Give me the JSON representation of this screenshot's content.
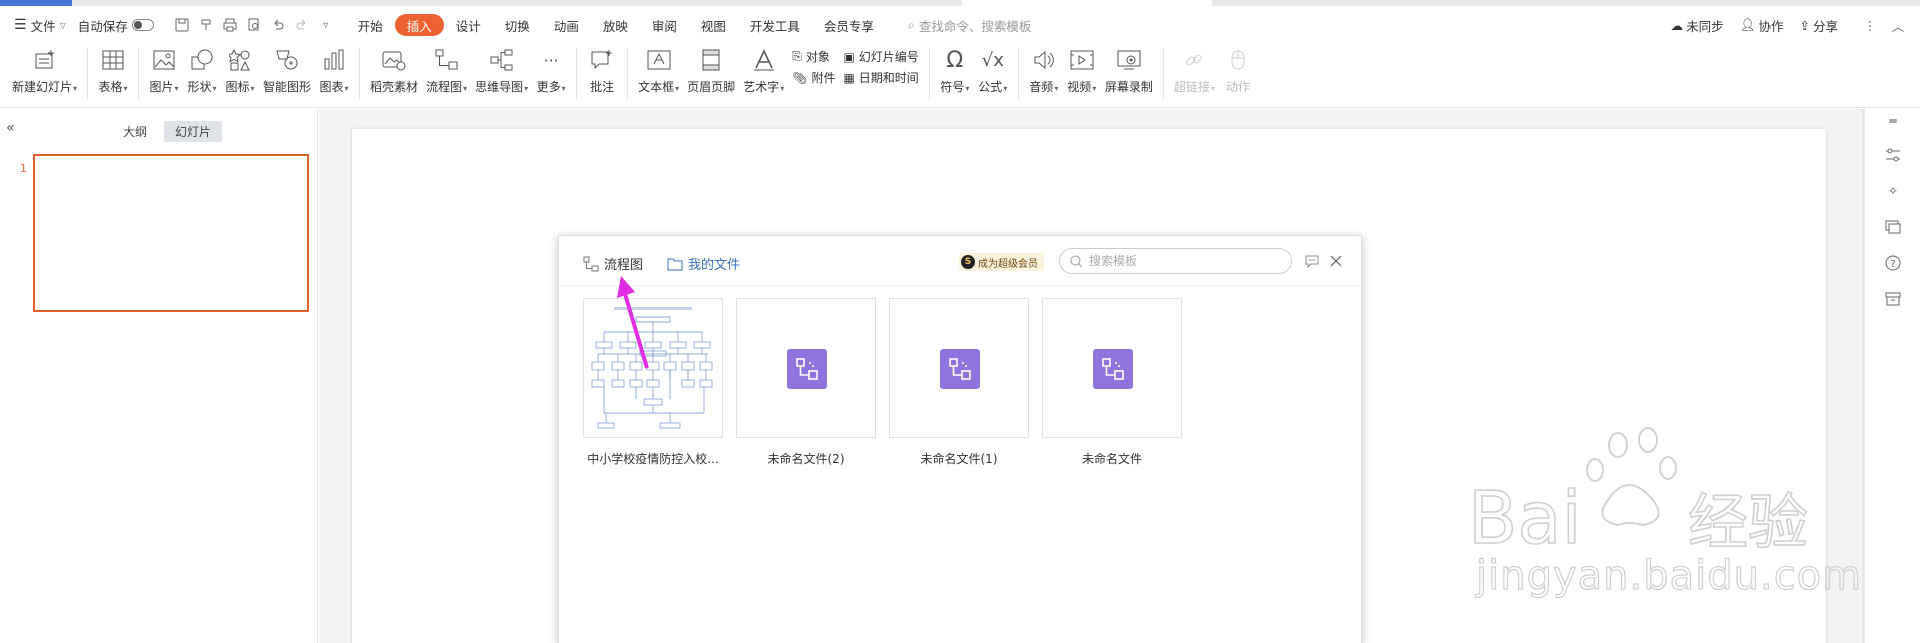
{
  "colors": {
    "accent": "#ec6231",
    "flow_icon": "#8f74de",
    "arrow": "#e02ee0"
  },
  "menubar": {
    "file_label": "文件",
    "autosave_label": "自动保存",
    "tabs": [
      "开始",
      "插入",
      "设计",
      "切换",
      "动画",
      "放映",
      "审阅",
      "视图",
      "开发工具",
      "会员专享"
    ],
    "active_tab": "插入",
    "search_cmd": "查找命令、搜索模板",
    "sync_label": "未同步",
    "collab_label": "协作",
    "share_label": "分享"
  },
  "ribbon": {
    "new_slide": "新建幻灯片",
    "table": "表格",
    "picture": "图片",
    "shape": "形状",
    "icon": "图标",
    "smart_graphic": "智能图形",
    "chart": "图表",
    "daoke": "稻壳素材",
    "flowchart": "流程图",
    "mindmap": "思维导图",
    "more": "更多",
    "comment": "批注",
    "textbox": "文本框",
    "header_footer": "页眉页脚",
    "wordart": "艺术字",
    "object": "对象",
    "attachment": "附件",
    "slide_number": "幻灯片编号",
    "date_time": "日期和时间",
    "symbol": "符号",
    "formula": "公式",
    "audio": "音频",
    "video": "视频",
    "screen_record": "屏幕录制",
    "hyperlink": "超链接",
    "action": "动作"
  },
  "leftpanel": {
    "tab_outline": "大纲",
    "tab_slides": "幻灯片",
    "slide_index": "1"
  },
  "dialog": {
    "tab_flowchart": "流程图",
    "tab_myfiles": "我的文件",
    "vip_label": "成为超级会员",
    "search_placeholder": "搜索模板",
    "files": [
      {
        "name": "中小学校疫情防控入校..."
      },
      {
        "name": "未命名文件(2)"
      },
      {
        "name": "未命名文件(1)"
      },
      {
        "name": "未命名文件"
      }
    ]
  },
  "watermark": {
    "brand": "Bai经验",
    "url": "jingyan.baidu.com"
  }
}
